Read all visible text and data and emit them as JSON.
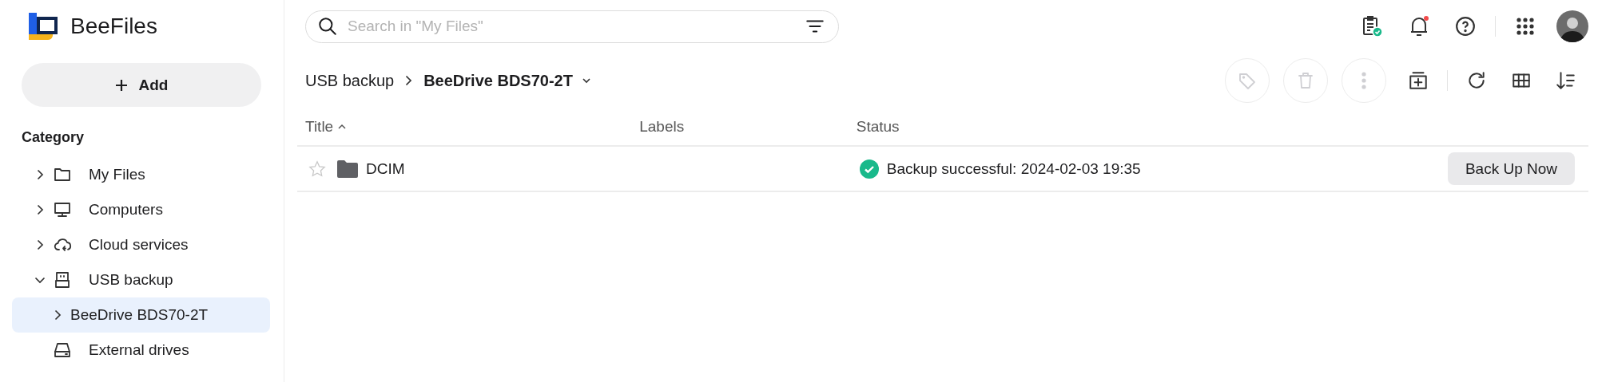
{
  "sidebar": {
    "brand": "BeeFiles",
    "add_button": "Add",
    "category_heading": "Category",
    "tree": [
      {
        "label": "My Files",
        "kind": "folder",
        "expanded": false,
        "selected": false
      },
      {
        "label": "Computers",
        "kind": "computer",
        "expanded": false,
        "selected": false
      },
      {
        "label": "Cloud services",
        "kind": "cloud",
        "expanded": false,
        "selected": false
      },
      {
        "label": "USB backup",
        "kind": "usb",
        "expanded": true,
        "selected": false,
        "children": [
          {
            "label": "BeeDrive BDS70-2T",
            "expanded": false,
            "selected": true
          }
        ]
      },
      {
        "label": "External drives",
        "kind": "drive",
        "selected": false
      }
    ]
  },
  "topbar": {
    "search": {
      "placeholder": "Search in \"My Files\""
    },
    "notifications": {
      "unread": true
    }
  },
  "breadcrumb": [
    {
      "label": "USB backup",
      "current": false
    },
    {
      "label": "BeeDrive BDS70-2T",
      "current": true
    }
  ],
  "actions": [
    {
      "kind": "tag",
      "disabled": true
    },
    {
      "kind": "delete",
      "disabled": true
    },
    {
      "kind": "more",
      "disabled": true
    }
  ],
  "table": {
    "columns": [
      {
        "label": "Title",
        "sorted": true
      },
      {
        "label": "Labels",
        "sorted": false
      },
      {
        "label": "Status",
        "sorted": false
      }
    ],
    "rows": [
      {
        "starred": false,
        "kind": "folder",
        "title": "DCIM",
        "status": "Backup successful: 2024-02-03 19:35",
        "succeeded": true,
        "action": "Back Up Now"
      }
    ]
  }
}
